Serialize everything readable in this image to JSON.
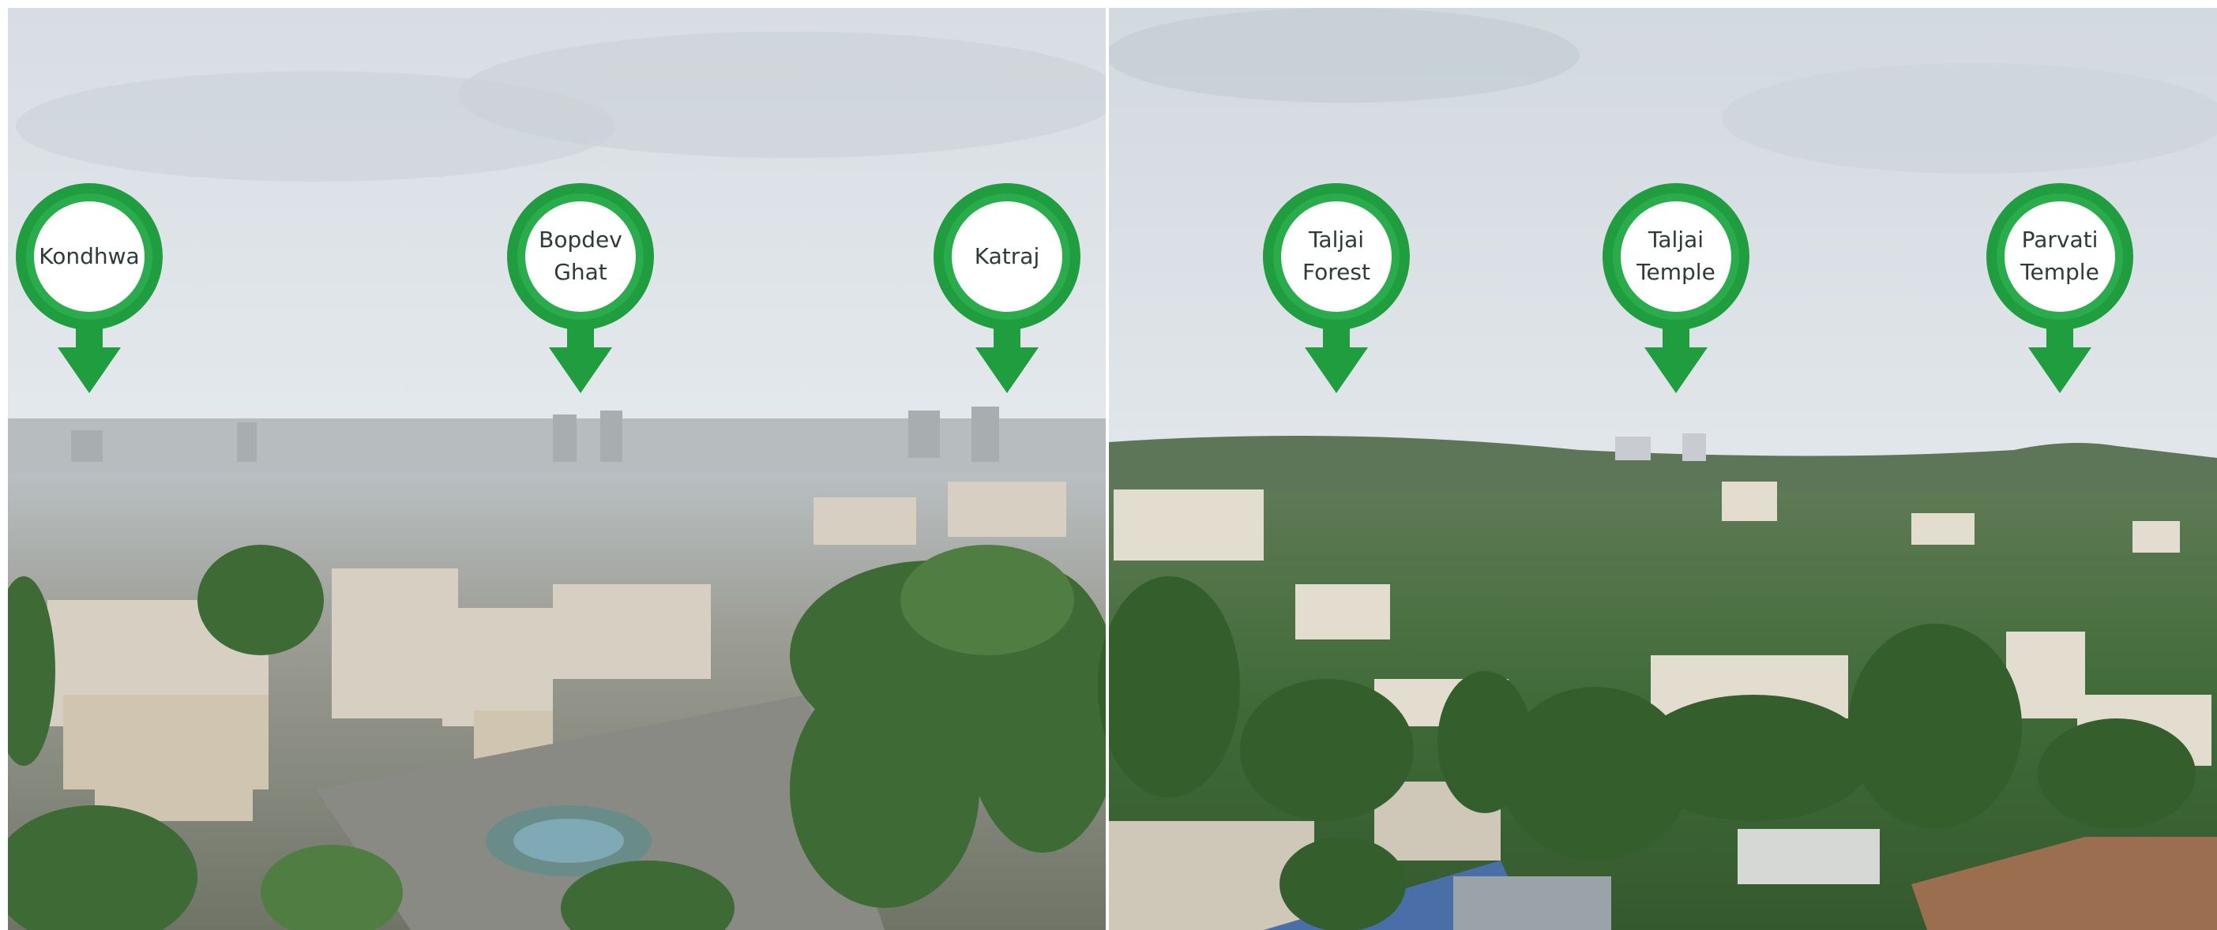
{
  "colors": {
    "marker_green": "#1f9d3f",
    "marker_green_dark": "#117a2d",
    "marker_inner_white": "#ffffff",
    "sky_top": "#dfe5ea",
    "sky_horizon": "#f2f4f5",
    "vegetation": "#3d6b3a",
    "buildings": "#c9c4bb"
  },
  "panels": [
    {
      "name": "left-panorama"
    },
    {
      "name": "right-panorama"
    }
  ],
  "markers": [
    {
      "id": "kondhwa",
      "label": "Kondhwa",
      "icon": "map-pin-icon"
    },
    {
      "id": "bopdev-ghat",
      "label": "Bopdev\nGhat",
      "icon": "map-pin-icon"
    },
    {
      "id": "katraj",
      "label": "Katraj",
      "icon": "map-pin-icon"
    },
    {
      "id": "taljai-forest",
      "label": "Taljai\nForest",
      "icon": "map-pin-icon"
    },
    {
      "id": "taljai-temple",
      "label": "Taljai\nTemple",
      "icon": "map-pin-icon"
    },
    {
      "id": "parvati-temple",
      "label": "Parvati\nTemple",
      "icon": "map-pin-icon"
    }
  ]
}
